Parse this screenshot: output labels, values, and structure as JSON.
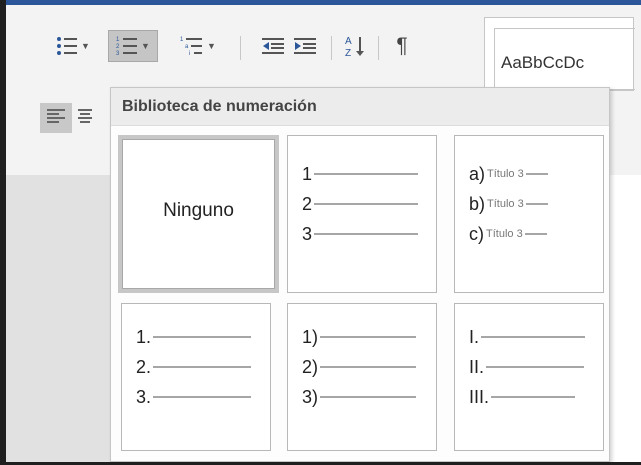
{
  "toolbar": {
    "bullets_icon": "bullet-list-icon",
    "numbering_icon": "numbered-list-icon",
    "multilevel_icon": "multilevel-list-icon",
    "decrease_indent_icon": "decrease-indent-icon",
    "increase_indent_icon": "increase-indent-icon",
    "sort_icon": "sort-az-icon",
    "pilcrow": "¶",
    "align_left_icon": "align-left-icon",
    "align_center_icon": "align-center-icon",
    "launcher": "⌟"
  },
  "styles": {
    "preview": "AaBbCcDc"
  },
  "numbering_library": {
    "title": "Biblioteca de numeración",
    "none_label": "Ninguno",
    "formats": [
      {
        "labels": [
          "1",
          "2",
          "3"
        ]
      },
      {
        "labels": [
          "a)",
          "b)",
          "c)"
        ],
        "suffix": "Título 3"
      },
      {
        "labels": [
          "1.",
          "2.",
          "3."
        ]
      },
      {
        "labels": [
          "1)",
          "2)",
          "3)"
        ]
      },
      {
        "labels": [
          "I.",
          "II.",
          "III."
        ]
      }
    ]
  },
  "colors": {
    "accent": "#2b579a",
    "selected_gray": "#c5c5c5",
    "line_gray": "#a6a6a6"
  }
}
